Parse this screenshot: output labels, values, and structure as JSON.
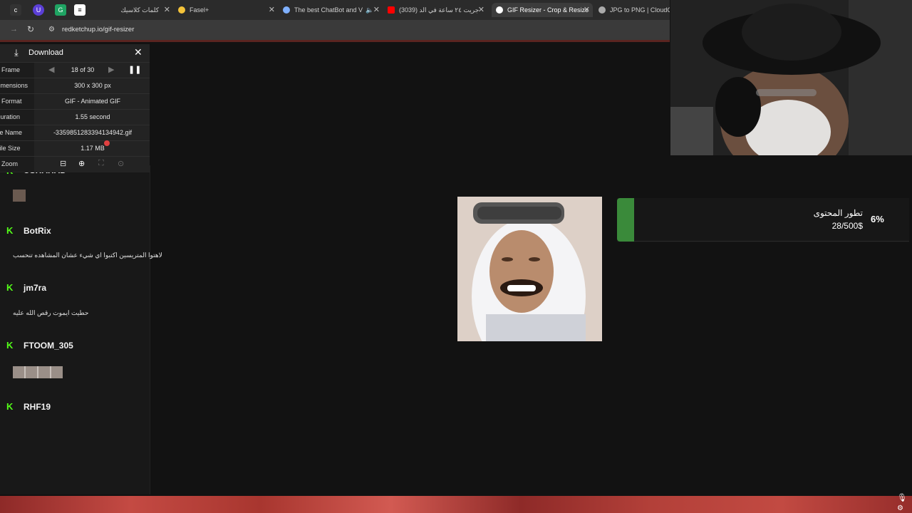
{
  "browser": {
    "tabs": [
      {
        "label": "كلمات كلاسيك",
        "active": false
      },
      {
        "label": "Fasel+",
        "active": false
      },
      {
        "label": "The best ChatBot and V",
        "active": false
      },
      {
        "label": "(3039) جريت ٢٤ ساعة في الد",
        "active": false
      },
      {
        "label": "GIF Resizer - Crop & Resize",
        "active": true
      },
      {
        "label": "JPG to PNG | CloudCon",
        "active": false
      }
    ],
    "url": "redketchup.io/gif-resizer"
  },
  "download_panel": {
    "title": "Download",
    "frame_label": "Frame",
    "frame_value": "18 of 30",
    "dimensions_label": "Dimensions",
    "dimensions_value": "300 x 300 px",
    "format_label": "Format",
    "format_value": "GIF - Animated GIF",
    "duration_label": "Duration",
    "duration_value": "1.55 second",
    "filename_label": "File Name",
    "filename_value": "-3359851283394134942.gif",
    "filesize_label": "File Size",
    "filesize_value": "1.17 MB",
    "zoom_label": "Zoom"
  },
  "chat": {
    "messages": [
      {
        "user": "USHAHAD",
        "text": ""
      },
      {
        "user": "BotRix",
        "text": "لاهتوا المتريسين اكتبوا اي شيء عشان المشاهده تنحسب"
      },
      {
        "user": "jm7ra",
        "text": "حطيت ايموت رقص الله عليه"
      },
      {
        "user": "FTOOM_305",
        "text": ""
      },
      {
        "user": "RHF19",
        "text": ""
      }
    ]
  },
  "goal": {
    "title": "تطور المحتوى",
    "amount": "28/500$",
    "percent": "6%",
    "progress_fraction": 0.06
  },
  "colors": {
    "kick_green": "#53fc18",
    "goal_green": "#3a8a3a"
  }
}
